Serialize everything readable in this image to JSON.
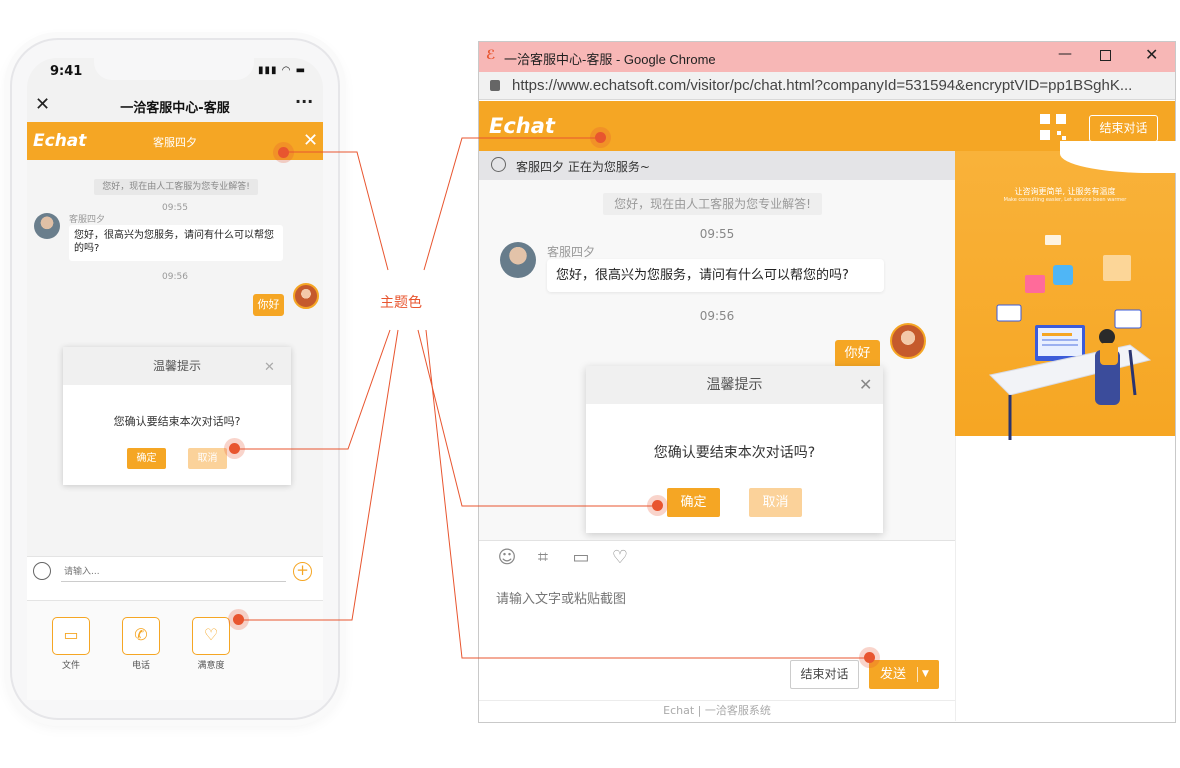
{
  "phone": {
    "status_time": "9:41",
    "status_icons": "▮▮▮ ◠ ▬",
    "nav_title": "一洽客服中心-客服",
    "nav_more": "···",
    "header_logo": "Echat",
    "header_agent": "客服四夕",
    "system_msg": "您好，现在由人工客服为您专业解答!",
    "time1": "09:55",
    "agent_name": "客服四夕",
    "agent_msg": "您好，很高兴为您服务，请问有什么可以帮您的吗?",
    "time2": "09:56",
    "user_msg": "你好",
    "dialog_title": "温馨提示",
    "dialog_msg": "您确认要结束本次对话吗?",
    "confirm": "确定",
    "cancel": "取消",
    "input_placeholder": "请输入...",
    "tray": [
      {
        "label": "文件",
        "icon": "folder-icon"
      },
      {
        "label": "电话",
        "icon": "phone-icon"
      },
      {
        "label": "满意度",
        "icon": "heart-icon"
      }
    ]
  },
  "annotation": {
    "label": "主题色"
  },
  "browser": {
    "window_title": "一洽客服中心-客服 - Google Chrome",
    "url": "https://www.echatsoft.com/visitor/pc/chat.html?companyId=531594&encryptVID=pp1BSghK...",
    "header_logo": "Echat",
    "end_chat_top": "结束对话",
    "status_text": "客服四夕 正在为您服务~",
    "system_msg": "您好，现在由人工客服为您专业解答!",
    "time1": "09:55",
    "agent_name": "客服四夕",
    "agent_msg": "您好，很高兴为您服务，请问有什么可以帮您的吗?",
    "time2": "09:56",
    "user_msg": "你好",
    "dialog_title": "温馨提示",
    "dialog_msg": "您确认要结束本次对话吗?",
    "confirm": "确定",
    "cancel": "取消",
    "input_placeholder": "请输入文字或粘贴截图",
    "end_chat_btn": "结束对话",
    "send_btn": "发送",
    "footer": "Echat | 一洽客服系统",
    "side_slogan": "让咨询更简单, 让服务有温度",
    "side_slogan_en": "Make consulting easier, Let service been warmer"
  },
  "colors": {
    "theme": "#f5a624",
    "theme_light": "#fbd29a",
    "marker": "#e8552f"
  }
}
